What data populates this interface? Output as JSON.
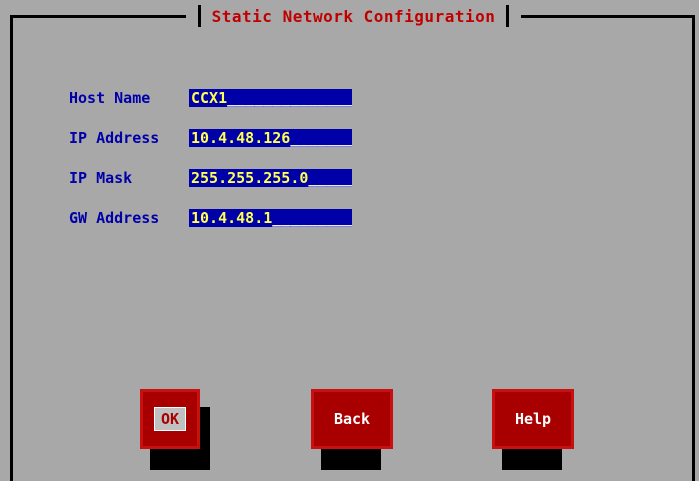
{
  "dialog": {
    "title": "Static Network Configuration"
  },
  "fields": [
    {
      "label": "Host Name",
      "value": "CCX1"
    },
    {
      "label": "IP Address",
      "value": "10.4.48.126"
    },
    {
      "label": "IP Mask",
      "value": "255.255.255.0"
    },
    {
      "label": "GW Address",
      "value": "10.4.48.1"
    }
  ],
  "buttons": {
    "ok": "OK",
    "back": "Back",
    "help": "Help"
  },
  "colors": {
    "background": "#a8a8a8",
    "title": "#c00000",
    "label": "#0000a8",
    "field_bg": "#0000a8",
    "field_text": "#ffff54",
    "button_bg": "#a80000"
  }
}
